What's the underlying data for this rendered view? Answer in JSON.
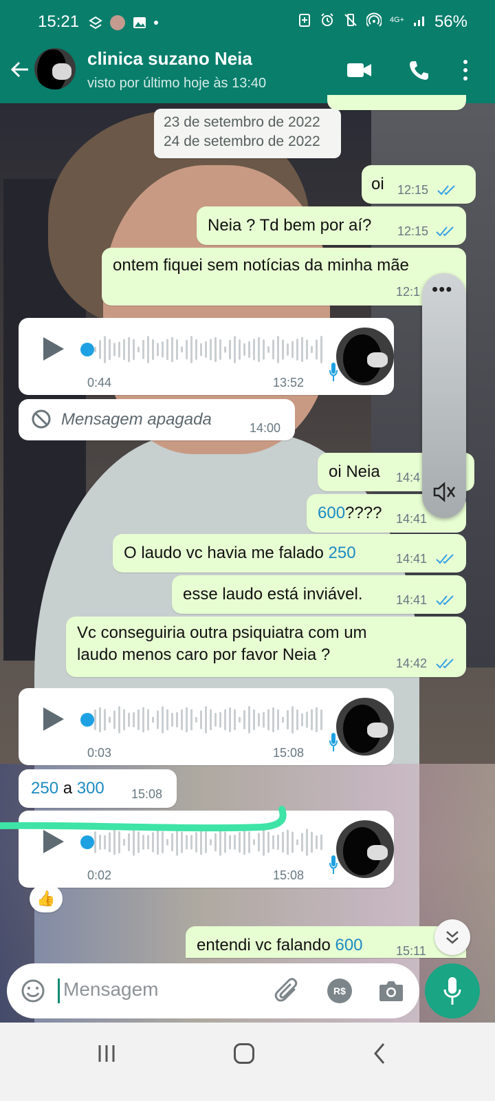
{
  "status_bar": {
    "time": "15:21",
    "network": "4G+",
    "battery": "56%"
  },
  "header": {
    "contact_name": "clinica suzano Neia",
    "last_seen": "visto por último hoje às 13:40"
  },
  "dates": {
    "current": "23 de setembro de 2022",
    "next": "24 de setembro de 2022"
  },
  "messages": [
    {
      "id": "m1",
      "text": "oi",
      "time": "12:15"
    },
    {
      "id": "m2",
      "text": "Neia ? Td bem por aí?",
      "time": "12:15"
    },
    {
      "id": "m3",
      "text": "ontem fiquei sem notícias da minha mãe",
      "time": "12:1"
    },
    {
      "id": "v1",
      "duration": "0:44",
      "time": "13:52"
    },
    {
      "id": "m4",
      "text": "Mensagem apagada",
      "time": "14:00"
    },
    {
      "id": "m5",
      "text": "oi Neia",
      "time": "14:4"
    },
    {
      "id": "m6",
      "number": "600",
      "suffix": "????",
      "time": "14:41"
    },
    {
      "id": "m7",
      "text": "O laudo vc havia me falado ",
      "number": "250",
      "time": "14:41"
    },
    {
      "id": "m8",
      "text": "esse laudo está inviável.",
      "time": "14:41"
    },
    {
      "id": "m9",
      "line1": "Vc conseguiria outra psiquiatra com um",
      "line2": "laudo menos caro por favor Neia ?",
      "time": "14:42"
    },
    {
      "id": "v2",
      "duration": "0:03",
      "time": "15:08"
    },
    {
      "id": "m10",
      "n1": "250",
      "mid": " a ",
      "n2": "300",
      "time": "15:08"
    },
    {
      "id": "v3",
      "duration": "0:02",
      "time": "15:08"
    },
    {
      "id": "m11",
      "text": "entendi vc falando ",
      "number": "600",
      "time": "15:11"
    }
  ],
  "reaction": "👍",
  "input": {
    "placeholder": "Mensagem",
    "currency_label": "R$"
  },
  "colors": {
    "header": "#087e6b",
    "outgoing_bubble": "#e7fdd2",
    "incoming_bubble": "#ffffff",
    "read_ticks": "#34a0e4",
    "link_number": "#1b8bc2",
    "mic_button": "#1aa584"
  },
  "icons": [
    "back-arrow-icon",
    "video-call-icon",
    "phone-icon",
    "more-options-icon",
    "play-icon",
    "mic-icon",
    "deleted-icon",
    "emoji-icon",
    "attach-icon",
    "payment-icon",
    "camera-icon",
    "scroll-down-icon",
    "mute-icon"
  ]
}
